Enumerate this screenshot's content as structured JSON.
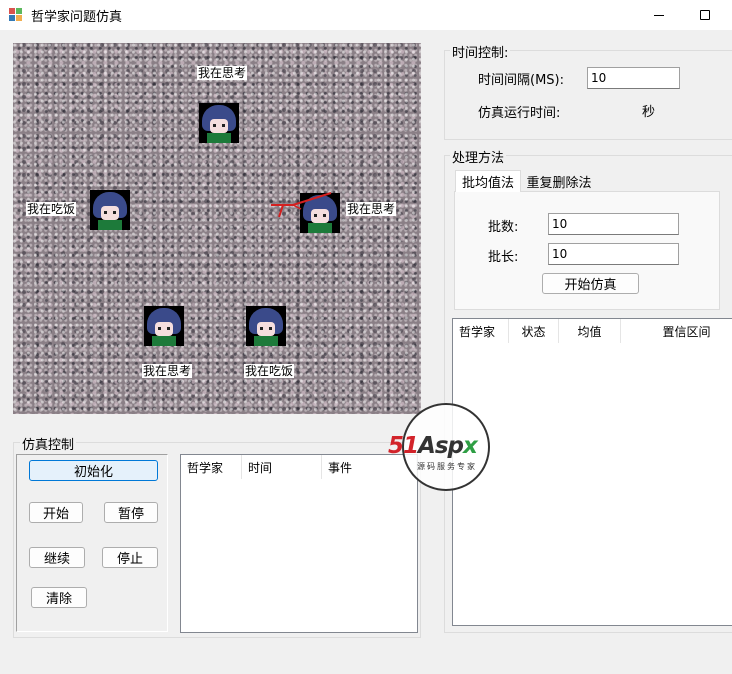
{
  "window": {
    "title": "哲学家问题仿真"
  },
  "simulation": {
    "philosophers": [
      {
        "status": "我在思考"
      },
      {
        "status": "我在吃饭"
      },
      {
        "status": "我在思考"
      },
      {
        "status": "我在思考"
      },
      {
        "status": "我在吃饭"
      }
    ]
  },
  "time_control": {
    "group_label": "时间控制:",
    "interval_label": "时间间隔(MS):",
    "interval_value": "10",
    "runtime_label": "仿真运行时间:",
    "runtime_unit": "秒"
  },
  "method": {
    "group_label": "处理方法",
    "tabs": [
      "批均值法",
      "重复删除法"
    ],
    "batch_count_label": "批数:",
    "batch_count_value": "10",
    "batch_length_label": "批长:",
    "batch_length_value": "10",
    "start_button": "开始仿真"
  },
  "results_table": {
    "columns": [
      "哲学家",
      "状态",
      "均值",
      "置信区间"
    ]
  },
  "sim_control": {
    "group_label": "仿真控制",
    "init_button": "初始化",
    "start_button": "开始",
    "pause_button": "暂停",
    "resume_button": "继续",
    "stop_button": "停止",
    "clear_button": "清除"
  },
  "event_log": {
    "columns": [
      "哲学家",
      "时间",
      "事件"
    ]
  },
  "watermark": {
    "brand": "51Aspx",
    "slogan": "源码服务专家"
  }
}
